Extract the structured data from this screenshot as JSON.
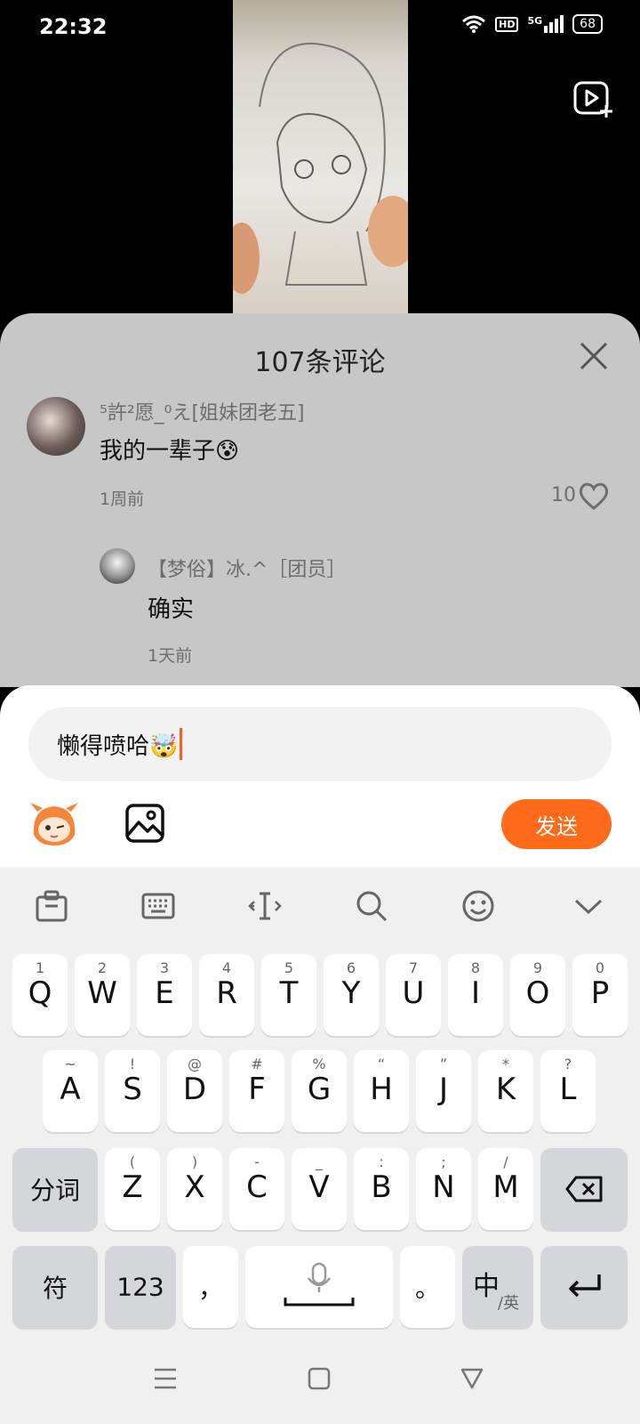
{
  "status": {
    "time": "22:32",
    "hd": "HD",
    "network": "5G",
    "battery": "68"
  },
  "comments": {
    "title": "107条评论",
    "items": [
      {
        "user": "⁵許²愿_⁰え[姐妹团老五]",
        "text": "我的一辈子😰",
        "time": "1周前",
        "likes": "10"
      },
      {
        "user": "【梦俗】冰.^［团员］",
        "text": "确实",
        "time": "1天前"
      }
    ]
  },
  "composer": {
    "value": "懒得喷哈🤯",
    "send_label": "发送"
  },
  "keyboard": {
    "row1": [
      {
        "s": "1",
        "k": "Q"
      },
      {
        "s": "2",
        "k": "W"
      },
      {
        "s": "3",
        "k": "E"
      },
      {
        "s": "4",
        "k": "R"
      },
      {
        "s": "5",
        "k": "T"
      },
      {
        "s": "6",
        "k": "Y"
      },
      {
        "s": "7",
        "k": "U"
      },
      {
        "s": "8",
        "k": "I"
      },
      {
        "s": "9",
        "k": "O"
      },
      {
        "s": "0",
        "k": "P"
      }
    ],
    "row2": [
      {
        "s": "~",
        "k": "A"
      },
      {
        "s": "!",
        "k": "S"
      },
      {
        "s": "@",
        "k": "D"
      },
      {
        "s": "#",
        "k": "F"
      },
      {
        "s": "%",
        "k": "G"
      },
      {
        "s": "“",
        "k": "H"
      },
      {
        "s": "”",
        "k": "J"
      },
      {
        "s": "*",
        "k": "K"
      },
      {
        "s": "?",
        "k": "L"
      }
    ],
    "row3": [
      {
        "s": "(",
        "k": "Z"
      },
      {
        "s": ")",
        "k": "X"
      },
      {
        "s": "-",
        "k": "C"
      },
      {
        "s": "_",
        "k": "V"
      },
      {
        "s": ":",
        "k": "B"
      },
      {
        "s": ";",
        "k": "N"
      },
      {
        "s": "/",
        "k": "M"
      }
    ],
    "fenci": "分词",
    "fu": "符",
    "num": "123",
    "comma": "，",
    "period": "。",
    "lang_main": "中",
    "lang_sub": "/英"
  }
}
